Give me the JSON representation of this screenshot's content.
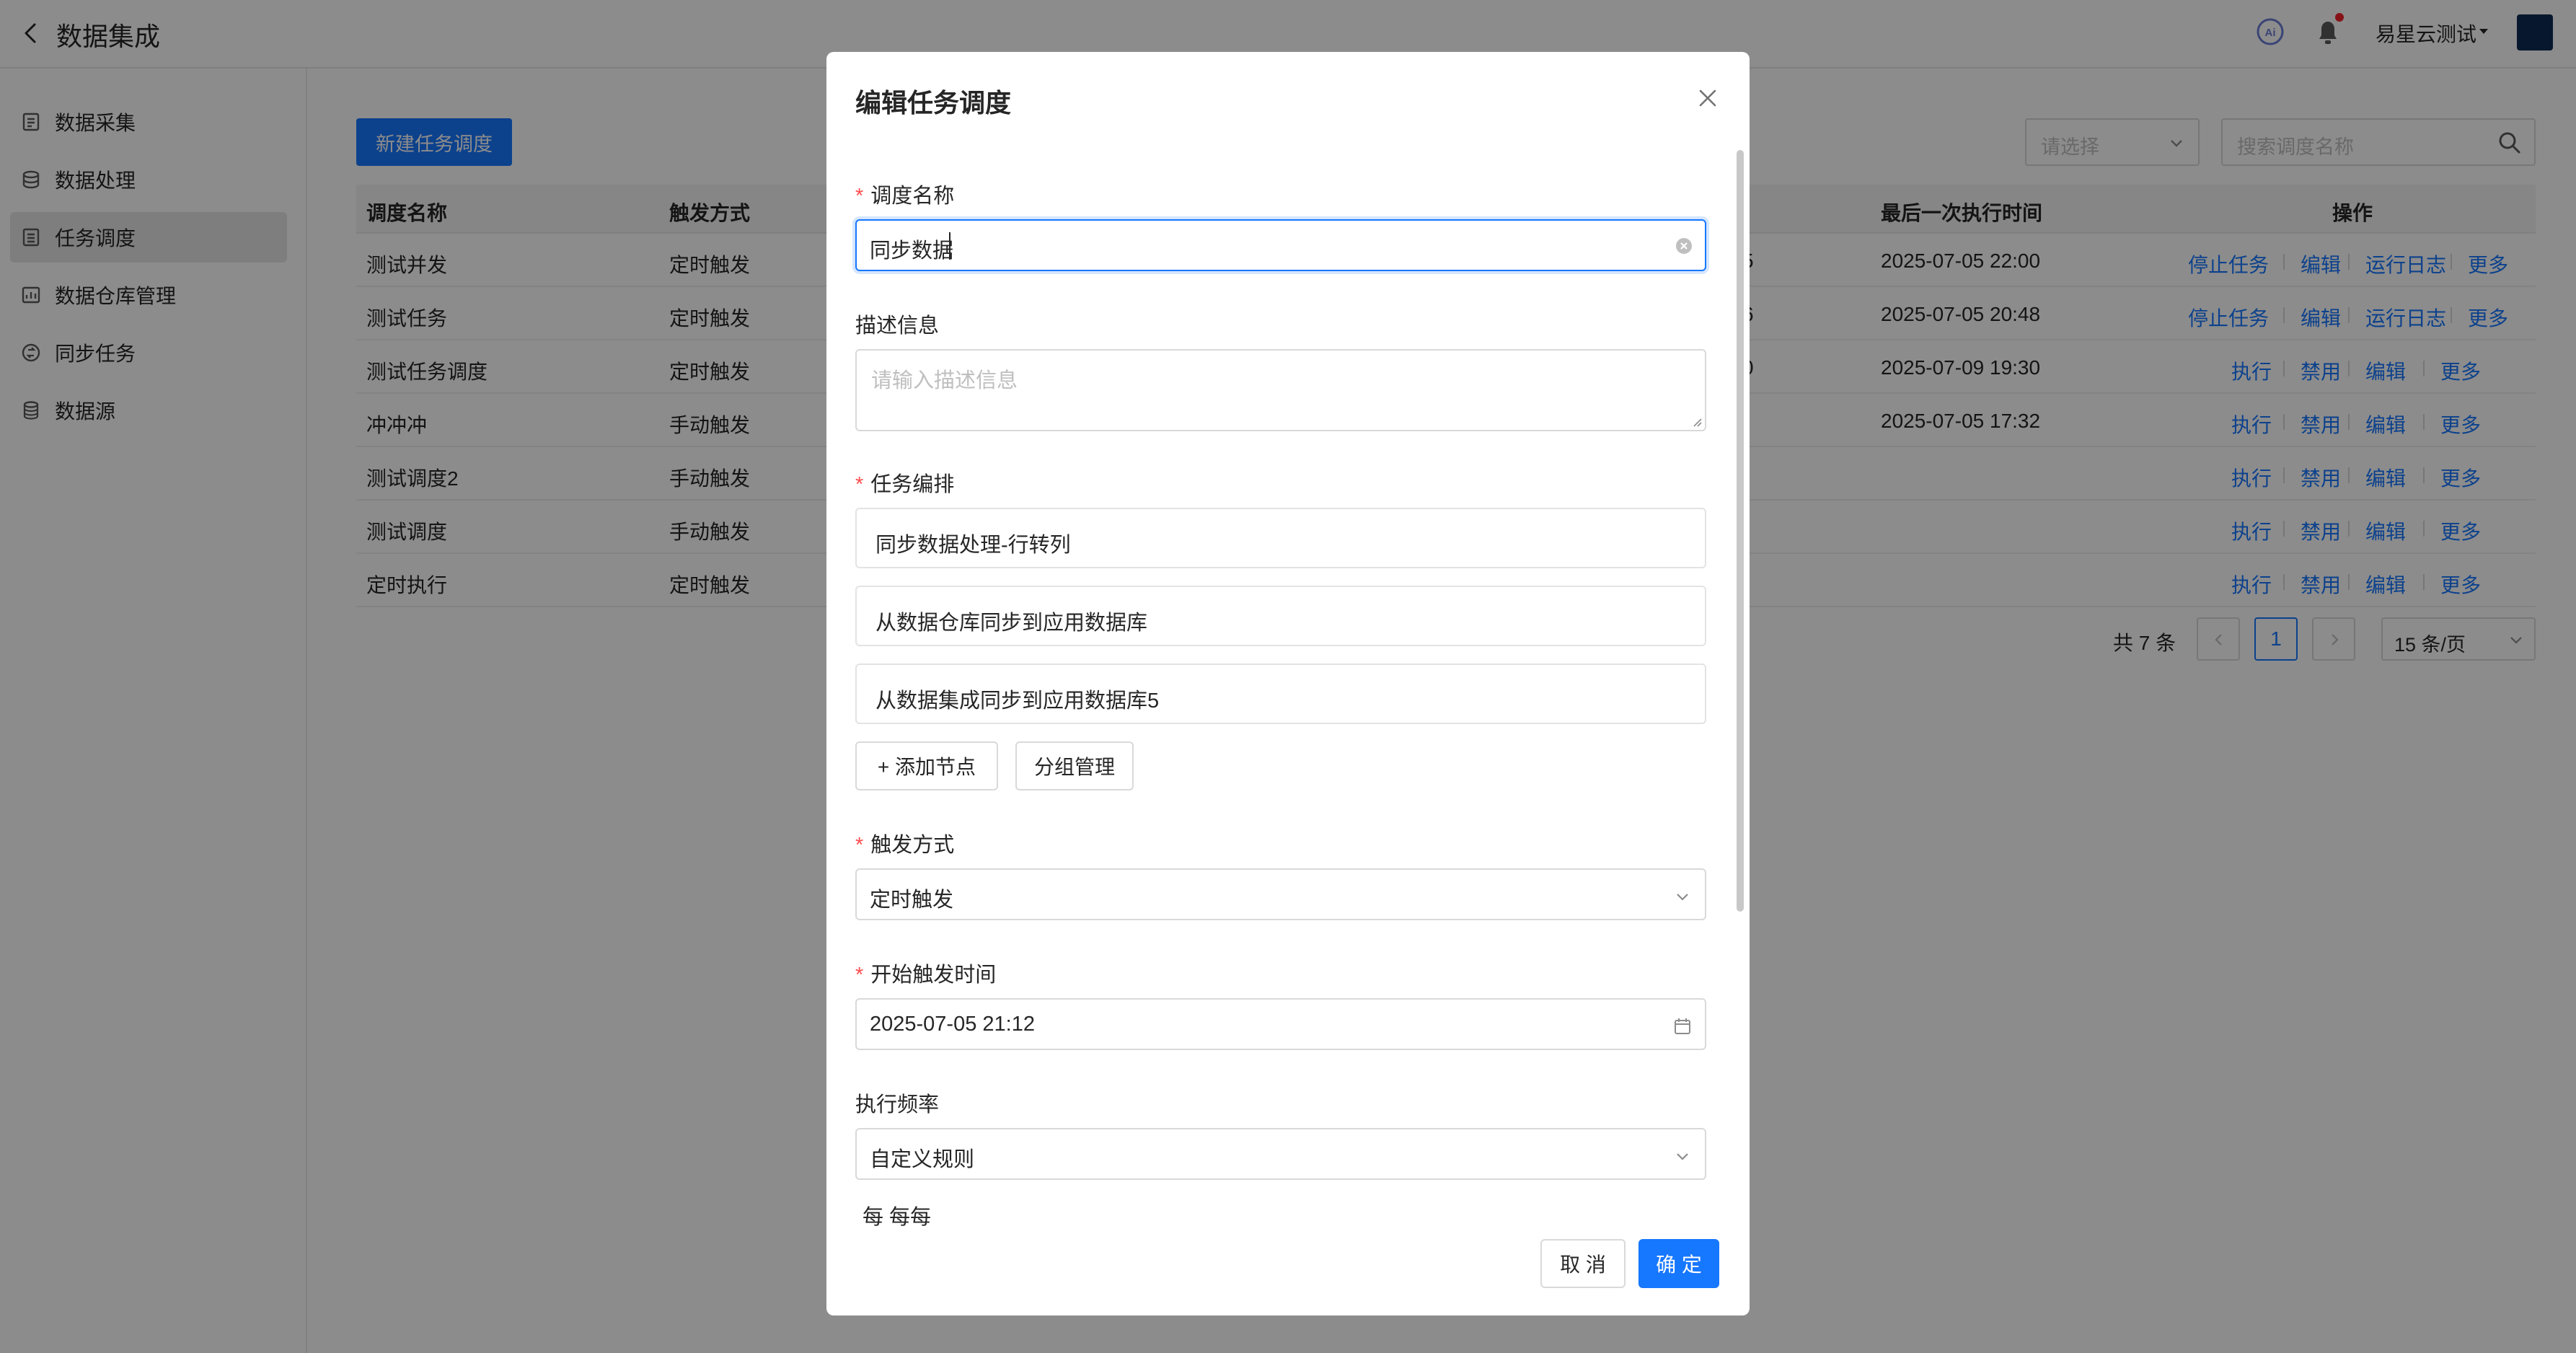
{
  "app": {
    "title": "数据集成"
  },
  "header": {
    "user_name": "易星云测试",
    "avatar_color": "#0e2a52"
  },
  "sidebar": {
    "items": [
      {
        "label": "数据采集",
        "icon": "collect-icon"
      },
      {
        "label": "数据处理",
        "icon": "process-icon"
      },
      {
        "label": "任务调度",
        "icon": "schedule-icon",
        "active": true
      },
      {
        "label": "数据仓库管理",
        "icon": "warehouse-icon"
      },
      {
        "label": "同步任务",
        "icon": "sync-icon"
      },
      {
        "label": "数据源",
        "icon": "datasource-icon"
      }
    ]
  },
  "toolbar": {
    "new_button": "新建任务调度",
    "filter_placeholder": "请选择",
    "search_placeholder": "搜索调度名称"
  },
  "table": {
    "headers": [
      "调度名称",
      "触发方式",
      "最后一次执行时间",
      "操作"
    ],
    "rows": [
      {
        "name": "测试并发",
        "trigger": "定时触发",
        "partial": "5",
        "last": "2025-07-05 22:00",
        "ops": [
          "停止任务",
          "编辑",
          "运行日志",
          "更多"
        ]
      },
      {
        "name": "测试任务",
        "trigger": "定时触发",
        "partial": "6",
        "last": "2025-07-05 20:48",
        "ops": [
          "停止任务",
          "编辑",
          "运行日志",
          "更多"
        ]
      },
      {
        "name": "测试任务调度",
        "trigger": "定时触发",
        "partial": "0",
        "last": "2025-07-09 19:30",
        "ops": [
          "执行",
          "禁用",
          "编辑",
          "更多"
        ]
      },
      {
        "name": "冲冲冲",
        "trigger": "手动触发",
        "partial": "",
        "last": "2025-07-05 17:32",
        "ops": [
          "执行",
          "禁用",
          "编辑",
          "更多"
        ]
      },
      {
        "name": "测试调度2",
        "trigger": "手动触发",
        "partial": "",
        "last": "",
        "ops": [
          "执行",
          "禁用",
          "编辑",
          "更多"
        ]
      },
      {
        "name": "测试调度",
        "trigger": "手动触发",
        "partial": "",
        "last": "",
        "ops": [
          "执行",
          "禁用",
          "编辑",
          "更多"
        ]
      },
      {
        "name": "定时执行",
        "trigger": "定时触发",
        "partial": "",
        "last": "",
        "ops": [
          "执行",
          "禁用",
          "编辑",
          "更多"
        ]
      }
    ]
  },
  "pagination": {
    "total": "共 7 条",
    "current": "1",
    "page_size": "15 条/页"
  },
  "modal": {
    "title": "编辑任务调度",
    "name_label": "调度名称",
    "name_value": "同步数据",
    "desc_label": "描述信息",
    "desc_placeholder": "请输入描述信息",
    "tasks_label": "任务编排",
    "tasks": [
      "同步数据处理-行转列",
      "从数据仓库同步到应用数据库",
      "从数据集成同步到应用数据库5"
    ],
    "add_node": "+ 添加节点",
    "group_manage": "分组管理",
    "trigger_label": "触发方式",
    "trigger_value": "定时触发",
    "start_label": "开始触发时间",
    "start_value": "2025-07-05 21:12",
    "freq_label": "执行频率",
    "freq_value": "自定义规则",
    "cut_text": "每      每每",
    "cancel": "取 消",
    "ok": "确 定"
  }
}
